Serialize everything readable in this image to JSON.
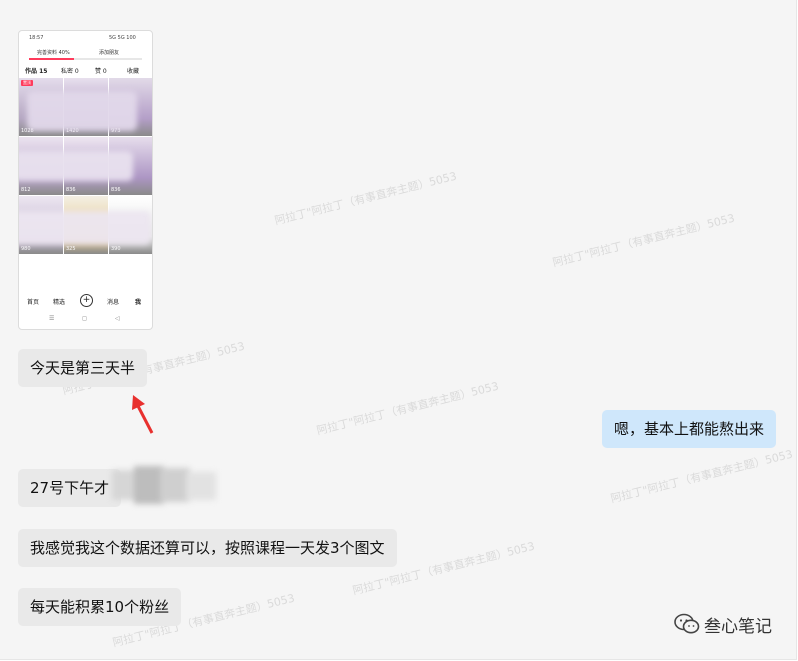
{
  "screenshot": {
    "status": {
      "left": "18:57",
      "right": "5G 5G 100"
    },
    "profile": {
      "left": "完善资料 40%",
      "right": "添加朋友"
    },
    "stats": {
      "works": "作品 15",
      "private": "私密 0",
      "likes": "赞 0",
      "fav": "收藏"
    },
    "profile_progress": 0.4,
    "tiles": [
      {
        "count": "1028",
        "tag": "置顶"
      },
      {
        "count": "1420"
      },
      {
        "count": "973"
      },
      {
        "count": "812"
      },
      {
        "count": "836"
      },
      {
        "count": "836"
      },
      {
        "count": "980"
      },
      {
        "count": "325"
      },
      {
        "count": "390"
      }
    ],
    "nav": {
      "home": "首页",
      "friends": "精选",
      "plus": "+",
      "messages": "消息",
      "me": "我"
    },
    "sysnav": {
      "menu": "☰",
      "home": "◻",
      "back": "◁"
    }
  },
  "messages": {
    "m1": "今天是第三天半",
    "m2": "嗯，基本上都能熬出来",
    "m3": "27号下午才",
    "m4": "我感觉我这个数据还算可以，按照课程一天发3个图文",
    "m5": "每天能积累10个粉丝"
  },
  "watermark": "阿拉丁\"阿拉丁（有事直奔主题）5053",
  "brand": {
    "name": "叁心笔记",
    "icon": "wechat-icon"
  },
  "colors": {
    "incoming": "#e9e9e9",
    "outgoing": "#cfe7fb",
    "arrow": "#e8302e"
  }
}
